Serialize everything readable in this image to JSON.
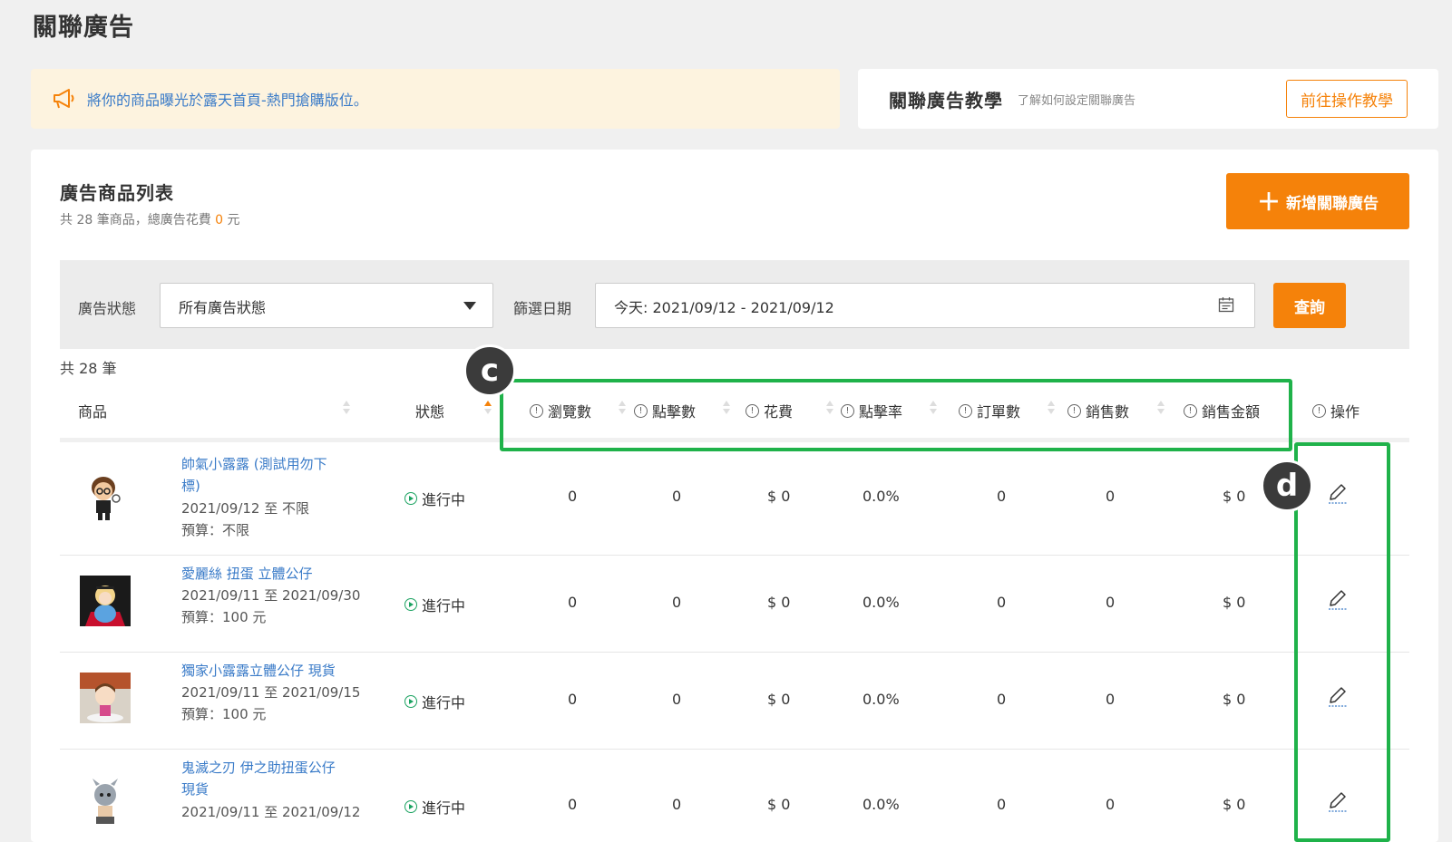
{
  "page_title": "關聯廣告",
  "banner": {
    "text": "將你的商品曝光於露天首頁-熱門搶購版位。",
    "icon": "megaphone-icon"
  },
  "tutorial": {
    "title": "關聯廣告教學",
    "subtitle": "了解如何設定關聯廣告",
    "button": "前往操作教學"
  },
  "list": {
    "title": "廣告商品列表",
    "summary_prefix": "共 28 筆商品，總廣告花費",
    "summary_amount": "0",
    "summary_suffix": "元",
    "add_button": "新增關聯廣告",
    "add_icon": "＋"
  },
  "filter": {
    "status_label": "廣告狀態",
    "status_value": "所有廣告狀態",
    "date_label": "篩選日期",
    "date_value": "今天:  2021/09/12 - 2021/09/12",
    "query_button": "查詢"
  },
  "count_text": "共 28 筆",
  "columns": {
    "product": "商品",
    "status": "狀態",
    "views": "瀏覽數",
    "clicks": "點擊數",
    "cost": "花費",
    "ctr": "點擊率",
    "orders": "訂單數",
    "sales": "銷售數",
    "revenue": "銷售金額",
    "action": "操作"
  },
  "rows": [
    {
      "name_line1": "帥氣小露露 (測試用勿下",
      "name_line2": "標)",
      "period": "2021/09/12 至 不限",
      "budget": "預算：不限",
      "status": "進行中",
      "views": "0",
      "clicks": "0",
      "cost": "$ 0",
      "ctr": "0.0%",
      "orders": "0",
      "sales": "0",
      "revenue": "$ 0"
    },
    {
      "name_line1": "愛麗絲 扭蛋 立體公仔",
      "period": "2021/09/11 至 2021/09/30",
      "budget": "預算：100 元",
      "status": "進行中",
      "views": "0",
      "clicks": "0",
      "cost": "$ 0",
      "ctr": "0.0%",
      "orders": "0",
      "sales": "0",
      "revenue": "$ 0"
    },
    {
      "name_line1": "獨家小露露立體公仔 現貨",
      "period": "2021/09/11 至 2021/09/15",
      "budget": "預算：100 元",
      "status": "進行中",
      "views": "0",
      "clicks": "0",
      "cost": "$ 0",
      "ctr": "0.0%",
      "orders": "0",
      "sales": "0",
      "revenue": "$ 0"
    },
    {
      "name_line1": "鬼滅之刃 伊之助扭蛋公仔",
      "name_line2": "現貨",
      "period": "2021/09/11 至 2021/09/12",
      "status": "進行中",
      "views": "0",
      "clicks": "0",
      "cost": "$ 0",
      "ctr": "0.0%",
      "orders": "0",
      "sales": "0",
      "revenue": "$ 0"
    }
  ],
  "annotations": {
    "c": "c",
    "d": "d"
  },
  "colors": {
    "accent": "#f5820a",
    "link": "#3a7bc8",
    "highlight": "#1fb24a",
    "running": "#1aa260"
  }
}
